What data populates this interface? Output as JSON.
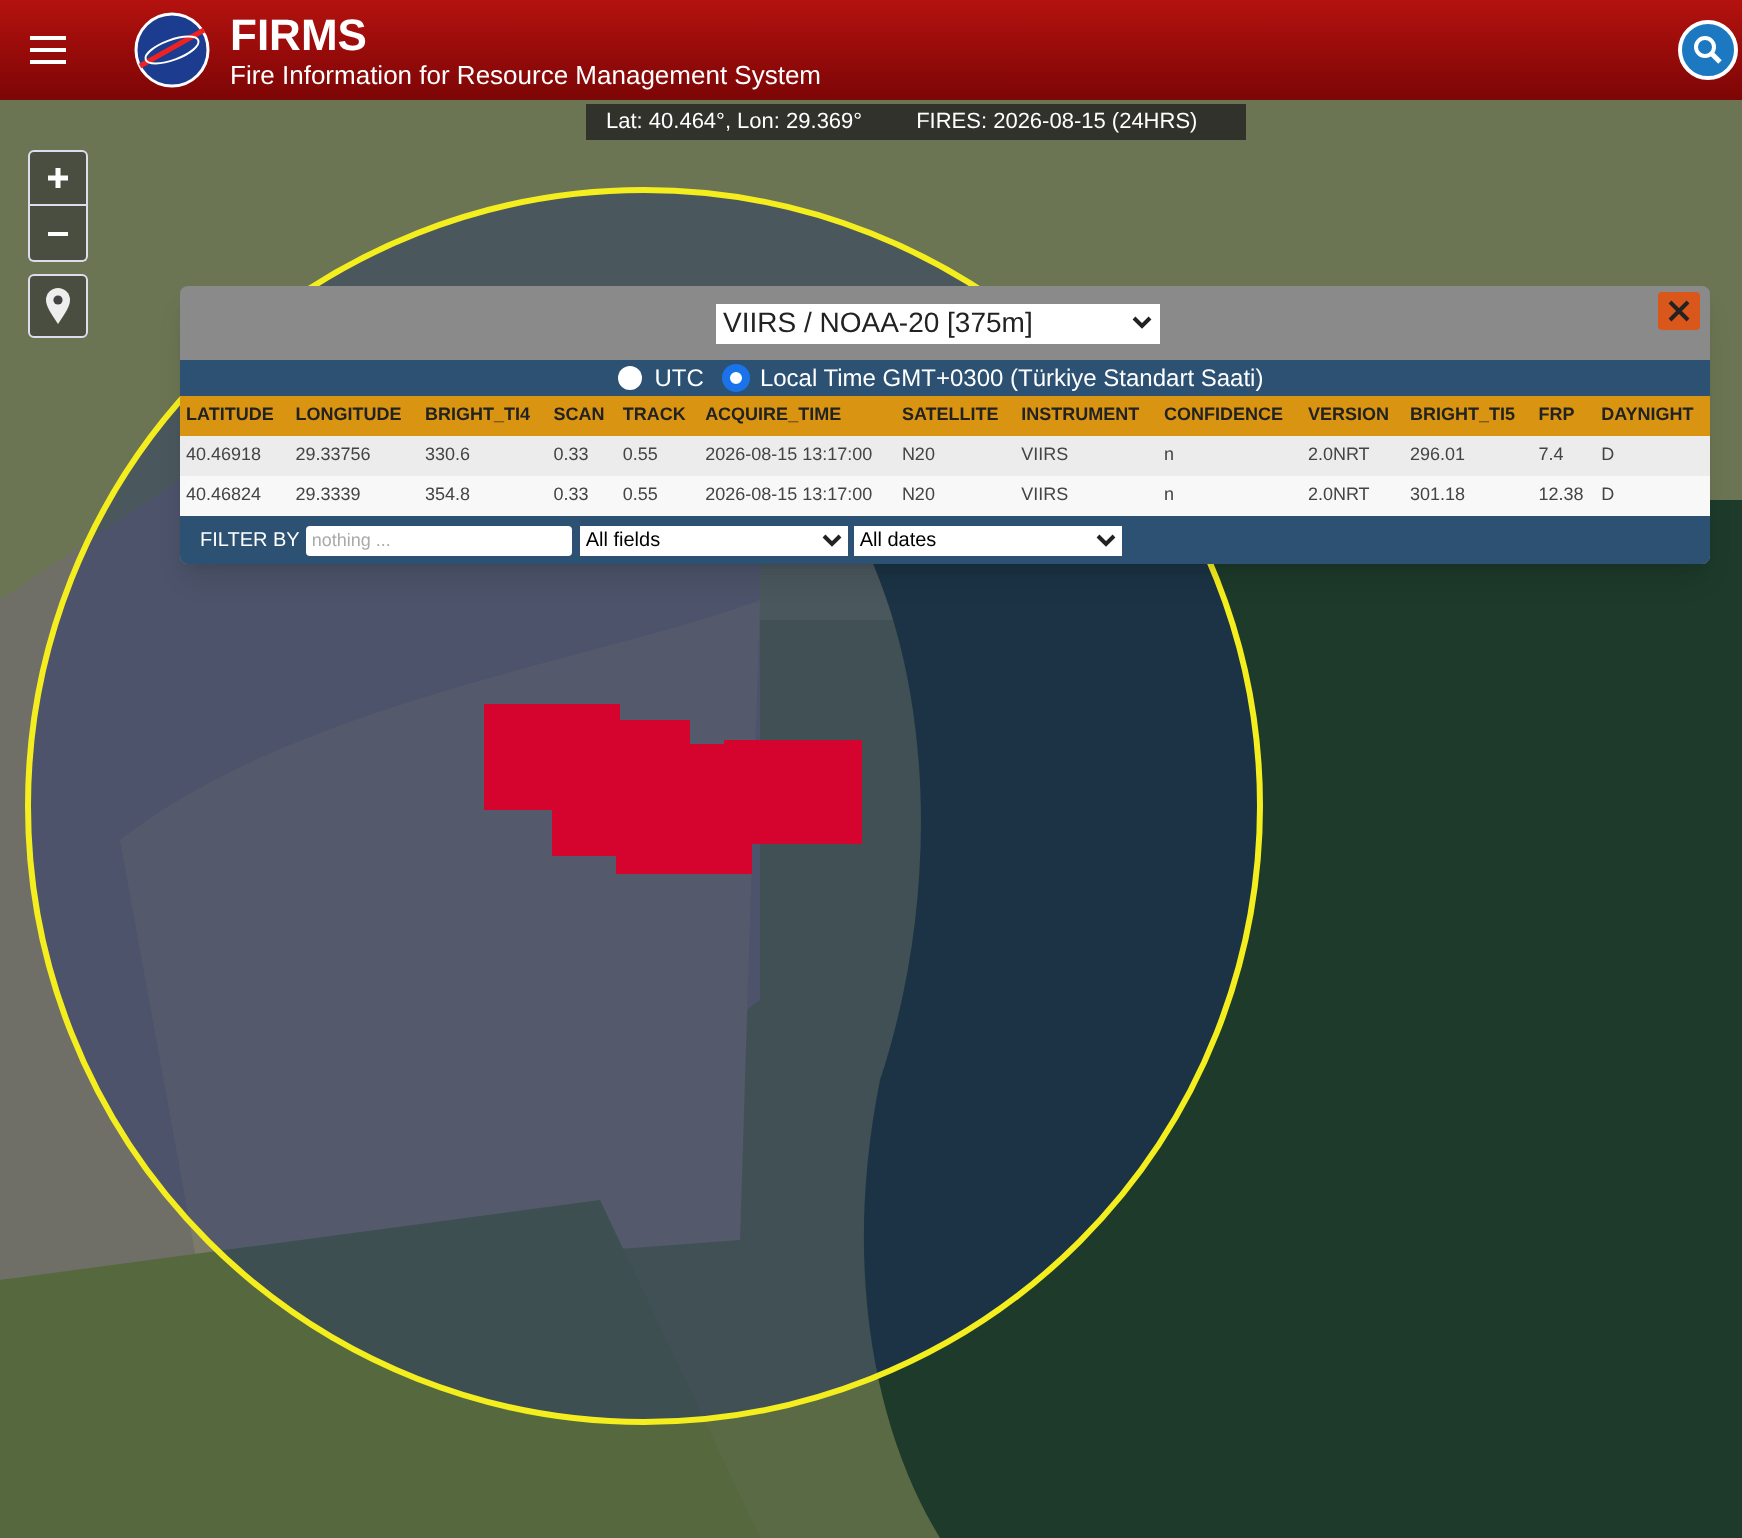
{
  "header": {
    "title": "FIRMS",
    "subtitle": "Fire Information for Resource Management System"
  },
  "status_bar": {
    "coordinates": "Lat: 40.464°, Lon: 29.369°",
    "fires": "FIRES: 2026-08-15 (24HRS)"
  },
  "popup": {
    "sensor_select": "VIIRS / NOAA-20 [375m]",
    "time_options": [
      {
        "label": "UTC",
        "selected": false
      },
      {
        "label": "Local Time GMT+0300 (Türkiye Standart Saati)",
        "selected": true
      }
    ],
    "table": {
      "columns": [
        "LATITUDE",
        "LONGITUDE",
        "BRIGHT_TI4",
        "SCAN",
        "TRACK",
        "ACQUIRE_TIME",
        "SATELLITE",
        "INSTRUMENT",
        "CONFIDENCE",
        "VERSION",
        "BRIGHT_TI5",
        "FRP",
        "DAYNIGHT"
      ],
      "rows": [
        [
          "40.46918",
          "29.33756",
          "330.6",
          "0.33",
          "0.55",
          "2026-08-15 13:17:00",
          "N20",
          "VIIRS",
          "n",
          "2.0NRT",
          "296.01",
          "7.4",
          "D"
        ],
        [
          "40.46824",
          "29.3339",
          "354.8",
          "0.33",
          "0.55",
          "2026-08-15 13:17:00",
          "N20",
          "VIIRS",
          "n",
          "2.0NRT",
          "301.18",
          "12.38",
          "D"
        ]
      ]
    },
    "filter": {
      "label": "FILTER BY",
      "placeholder": "nothing ...",
      "field_select": "All fields",
      "date_select": "All dates"
    }
  }
}
